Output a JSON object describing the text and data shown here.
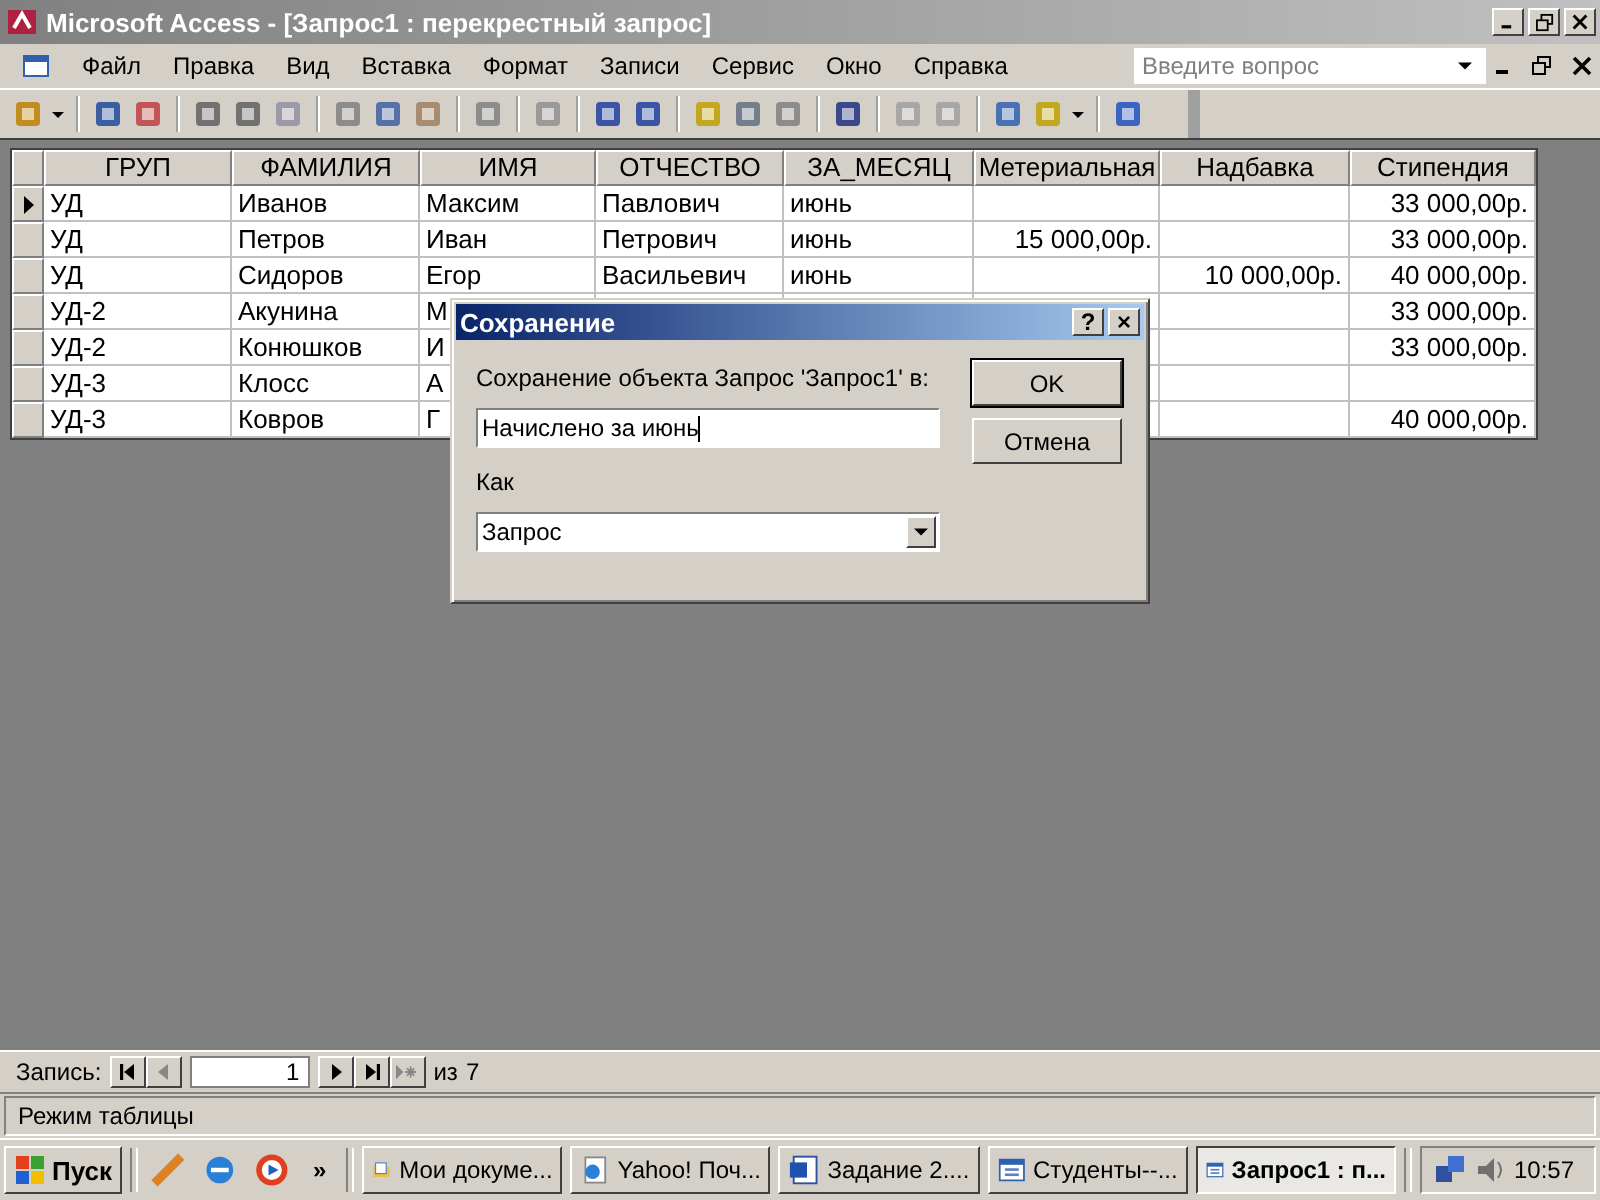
{
  "window": {
    "title": "Microsoft Access - [Запрос1 : перекрестный запрос]"
  },
  "menu": [
    "Файл",
    "Правка",
    "Вид",
    "Вставка",
    "Формат",
    "Записи",
    "Сервис",
    "Окно",
    "Справка"
  ],
  "help_search": {
    "placeholder": "Введите вопрос"
  },
  "table": {
    "columns": [
      "ГРУП",
      "ФАМИЛИЯ",
      "ИМЯ",
      "ОТЧЕСТВО",
      "ЗА_МЕСЯЦ",
      "Метериальная",
      "Надбавка",
      "Стипендия"
    ],
    "rows": [
      {
        "current": true,
        "cells": [
          "УД",
          "Иванов",
          "Максим",
          "Павлович",
          "июнь",
          null,
          null,
          "33 000,00р."
        ]
      },
      {
        "current": false,
        "cells": [
          "УД",
          "Петров",
          "Иван",
          "Петрович",
          "июнь",
          "15 000,00р.",
          null,
          "33 000,00р."
        ]
      },
      {
        "current": false,
        "cells": [
          "УД",
          "Сидоров",
          "Егор",
          "Васильевич",
          "июнь",
          null,
          "10 000,00р.",
          "40 000,00р."
        ]
      },
      {
        "current": false,
        "cells": [
          "УД-2",
          "Акунина",
          "М",
          null,
          null,
          null,
          null,
          "33 000,00р."
        ]
      },
      {
        "current": false,
        "cells": [
          "УД-2",
          "Конюшков",
          "И",
          null,
          null,
          null,
          null,
          "33 000,00р."
        ]
      },
      {
        "current": false,
        "cells": [
          "УД-3",
          "Клосс",
          "А",
          null,
          null,
          null,
          null,
          null
        ]
      },
      {
        "current": false,
        "cells": [
          "УД-3",
          "Ковров",
          "Г",
          null,
          null,
          null,
          null,
          "40 000,00р."
        ]
      }
    ]
  },
  "dialog": {
    "title": "Сохранение",
    "help_button": "?",
    "close_button": "×",
    "prompt": "Сохранение объекта Запрос 'Запрос1' в:",
    "name_value": "Начислено за июнь",
    "as_label": "Как",
    "as_value": "Запрос",
    "buttons": [
      "OK",
      "Отмена"
    ]
  },
  "record_nav": {
    "label": "Запись:",
    "current": "1",
    "of_label": "из",
    "total": "7"
  },
  "status_bar": "Режим таблицы",
  "taskbar": {
    "start": "Пуск",
    "more": "»",
    "tasks": [
      {
        "label": "Мои докуме...",
        "selected": false,
        "kind": "folder"
      },
      {
        "label": "Yahoo! Поч...",
        "selected": false,
        "kind": "web"
      },
      {
        "label": "Задание 2....",
        "selected": false,
        "kind": "word"
      },
      {
        "label": "Студенты--...",
        "selected": false,
        "kind": "window"
      },
      {
        "label": "Запрос1 : п...",
        "selected": true,
        "kind": "window"
      }
    ],
    "clock": "10:57"
  }
}
